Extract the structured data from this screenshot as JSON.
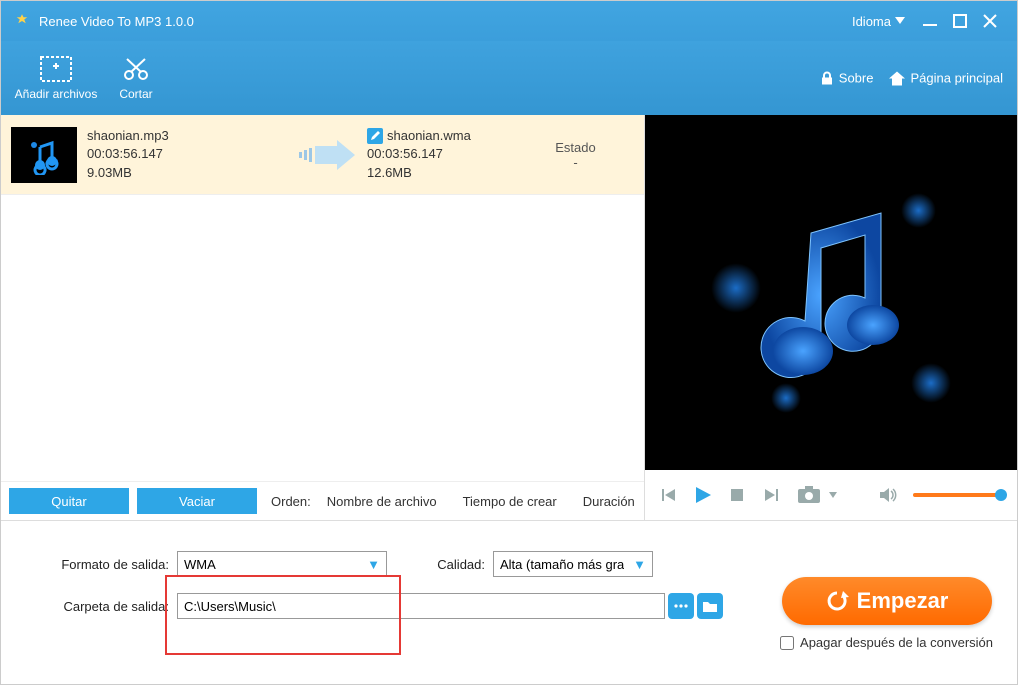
{
  "titlebar": {
    "app_title": "Renee Video To MP3 1.0.0",
    "language_label": "Idioma"
  },
  "toolbar": {
    "add_files": "Añadir archivos",
    "cut": "Cortar",
    "about": "Sobre",
    "home": "Página principal"
  },
  "list": {
    "status_header": "Estado",
    "source": {
      "name": "shaonian.mp3",
      "duration": "00:03:56.147",
      "size": "9.03MB"
    },
    "target": {
      "name": "shaonian.wma",
      "duration": "00:03:56.147",
      "size": "12.6MB"
    },
    "status_value": "-"
  },
  "list_footer": {
    "remove": "Quitar",
    "empty": "Vaciar",
    "order_label": "Orden:",
    "col_name": "Nombre de archivo",
    "col_time": "Tiempo de crear",
    "col_duration": "Duración"
  },
  "bottom": {
    "format_label": "Formato de salida:",
    "format_value": "WMA",
    "quality_label": "Calidad:",
    "quality_value": "Alta (tamaño más gra",
    "folder_label": "Carpeta de salida:",
    "folder_value": "C:\\Users\\Music\\",
    "start": "Empezar",
    "shutdown": "Apagar después de la conversión"
  }
}
